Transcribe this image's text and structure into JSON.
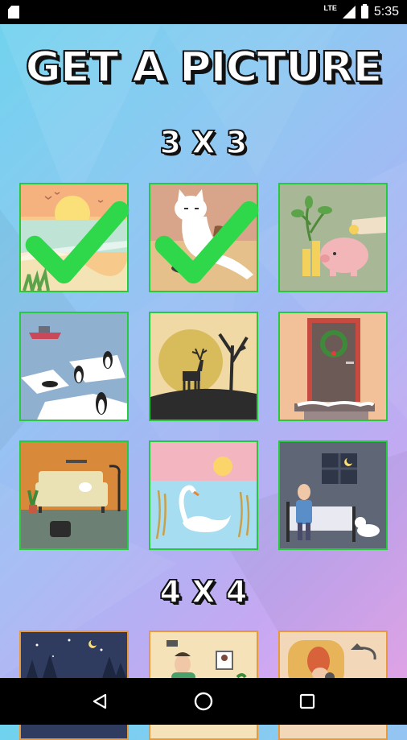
{
  "status_bar": {
    "network": "LTE",
    "time": "5:35"
  },
  "title": "GET A PICTURE",
  "sections": [
    {
      "label": "3 X 3",
      "pictures": [
        {
          "name": "beach-sunset",
          "completed": true
        },
        {
          "name": "cat-with-bowl",
          "completed": true
        },
        {
          "name": "piggy-bank",
          "completed": false
        },
        {
          "name": "penguins-on-ice",
          "completed": false
        },
        {
          "name": "deer-silhouette",
          "completed": false
        },
        {
          "name": "christmas-door",
          "completed": false
        },
        {
          "name": "living-room-cat",
          "completed": false
        },
        {
          "name": "swan-lake",
          "completed": false
        },
        {
          "name": "bedroom-cat",
          "completed": false
        }
      ]
    },
    {
      "label": "4 X 4",
      "pictures": [
        {
          "name": "night-forest",
          "completed": false
        },
        {
          "name": "man-with-hammer",
          "completed": false
        },
        {
          "name": "girl-in-armchair",
          "completed": false
        }
      ]
    }
  ],
  "colors": {
    "completed_border": "#27c93f",
    "locked_border": "#e89a3a",
    "check": "#2ed84a"
  },
  "nav": {
    "back_icon": "back-triangle-icon",
    "home_icon": "home-circle-icon",
    "recents_icon": "recents-square-icon"
  }
}
